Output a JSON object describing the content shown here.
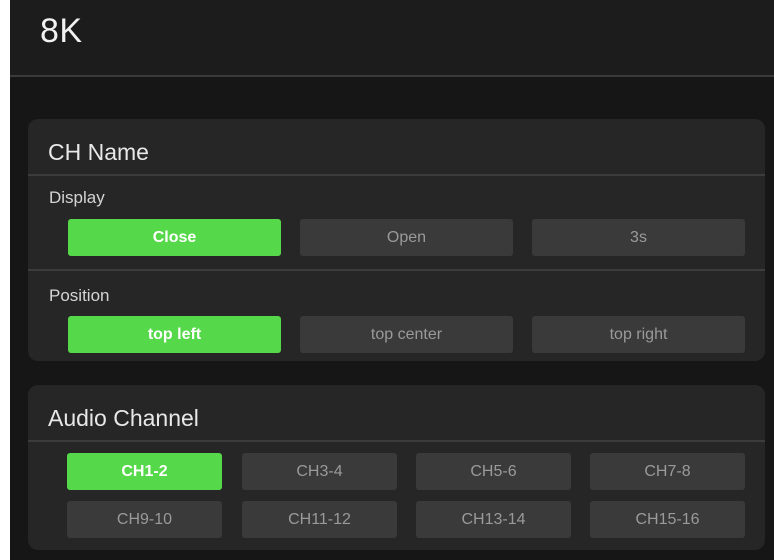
{
  "header": {
    "title": "8K"
  },
  "ch_name": {
    "title": "CH Name",
    "display": {
      "label": "Display",
      "options": [
        "Close",
        "Open",
        "3s"
      ],
      "selected": "Close"
    },
    "position": {
      "label": "Position",
      "options": [
        "top left",
        "top center",
        "top right"
      ],
      "selected": "top left"
    }
  },
  "audio_channel": {
    "title": "Audio Channel",
    "channels": [
      "CH1-2",
      "CH3-4",
      "CH5-6",
      "CH7-8",
      "CH9-10",
      "CH11-12",
      "CH13-14",
      "CH15-16"
    ],
    "selected": "CH1-2"
  },
  "colors": {
    "accent": "#55d94a",
    "panel": "#262626",
    "background": "#161616",
    "button": "#3a3a3a"
  }
}
